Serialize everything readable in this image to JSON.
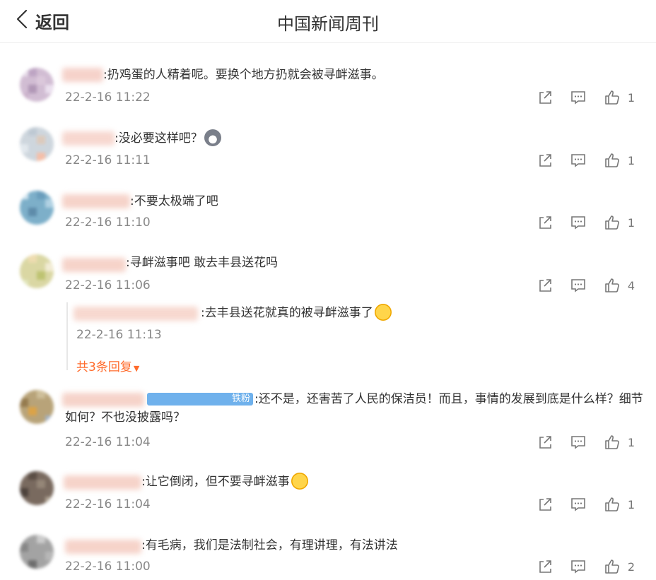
{
  "header": {
    "back_label": "返回",
    "title": "中国新闻周刊"
  },
  "comments": [
    {
      "text": ":扔鸡蛋的人精着呢。要换个地方扔就会被寻衅滋事。",
      "time": "22-2-16 11:22",
      "likes": "1"
    },
    {
      "text": ":没必要这样吧？",
      "time": "22-2-16 11:11",
      "likes": "1",
      "emoji": "husky-emoji"
    },
    {
      "text": ":不要太极端了吧",
      "time": "22-2-16 11:10",
      "likes": "1"
    },
    {
      "text": ":寻衅滋事吧 敢去丰县送花吗",
      "time": "22-2-16 11:06",
      "likes": "4",
      "reply": {
        "text": ":去丰县送花就真的被寻衅滋事了",
        "time": "22-2-16 11:13",
        "emoji": "laugh-cry-emoji"
      },
      "more_replies": "共3条回复"
    },
    {
      "badge": "铁粉",
      "text": ":还不是，还害苦了人民的保洁员！而且，事情的发展到底是什么样？细节如何？不也没披露吗？",
      "time": "22-2-16 11:04",
      "likes": "1"
    },
    {
      "text": ":让它倒闭，但不要寻衅滋事",
      "time": "22-2-16 11:04",
      "likes": "1",
      "emoji": "laugh-cry-emoji"
    },
    {
      "text": ":有毛病，我们是法制社会，有理讲理，有法讲法",
      "time": "22-2-16 11:00",
      "likes": "2"
    }
  ]
}
